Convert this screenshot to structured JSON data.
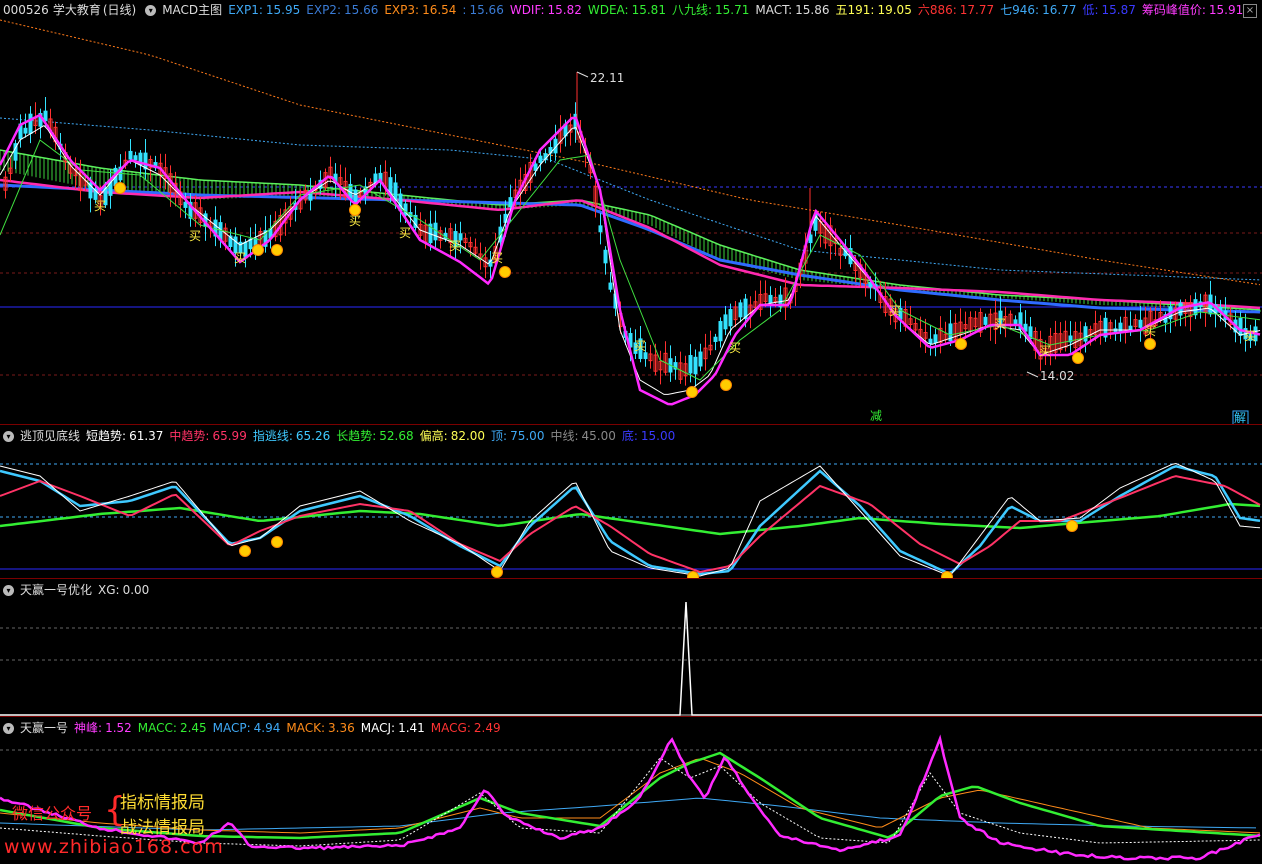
{
  "main": {
    "stock_code": "000526",
    "stock_name": "学大教育",
    "period": "(日线)",
    "indicator": "MACD主图",
    "values": [
      {
        "label": "EXP1:",
        "value": "15.95",
        "color": "#3fa9f5"
      },
      {
        "label": "EXP2:",
        "value": "15.66",
        "color": "#3a7bd5"
      },
      {
        "label": "EXP3:",
        "value": "16.54",
        "color": "#ff8c1a"
      },
      {
        "label": ":",
        "value": "15.66",
        "color": "#3a7bd5"
      },
      {
        "label": "WDIF:",
        "value": "15.82",
        "color": "#ff3cff"
      },
      {
        "label": "WDEA:",
        "value": "15.81",
        "color": "#33ee33"
      },
      {
        "label": "八九线:",
        "value": "15.71",
        "color": "#33ee33"
      },
      {
        "label": "MACT:",
        "value": "15.86",
        "color": "#dddddd"
      },
      {
        "label": "五191:",
        "value": "19.05",
        "color": "#ffff55"
      },
      {
        "label": "六886:",
        "value": "17.77",
        "color": "#ff3333"
      },
      {
        "label": "七946:",
        "value": "16.77",
        "color": "#3fa9f5"
      },
      {
        "label": "低:",
        "value": "15.87",
        "color": "#3a3aff"
      },
      {
        "label": "筹码峰值价:",
        "value": "15.91",
        "color": "#ff3cff"
      }
    ],
    "high_label": "22.11",
    "low_label": "14.02",
    "buy_mark": "买",
    "reduce_mark": "减",
    "release_mark": "解"
  },
  "escape": {
    "title": "逃顶见底线",
    "values": [
      {
        "label": "短趋势:",
        "value": "61.37",
        "color": "#ffffff"
      },
      {
        "label": "中趋势:",
        "value": "65.99",
        "color": "#ff3366"
      },
      {
        "label": "指逃线:",
        "value": "65.26",
        "color": "#3fc9ff"
      },
      {
        "label": "长趋势:",
        "value": "52.68",
        "color": "#33ee33"
      },
      {
        "label": "偏高:",
        "value": "82.00",
        "color": "#ffff55"
      },
      {
        "label": "顶:",
        "value": "75.00",
        "color": "#3fa9f5"
      },
      {
        "label": "中线:",
        "value": "45.00",
        "color": "#888888"
      },
      {
        "label": "底:",
        "value": "15.00",
        "color": "#3a3aff"
      }
    ]
  },
  "tianying_opt": {
    "title": "天赢一号优化",
    "values": [
      {
        "label": "XG:",
        "value": "0.00",
        "color": "#dddddd"
      }
    ]
  },
  "tianying": {
    "title": "天赢一号",
    "values": [
      {
        "label": "神峰:",
        "value": "1.52",
        "color": "#ff3cff"
      },
      {
        "label": "MACC:",
        "value": "2.45",
        "color": "#33ee33"
      },
      {
        "label": "MACP:",
        "value": "4.94",
        "color": "#3fa9f5"
      },
      {
        "label": "MACK:",
        "value": "3.36",
        "color": "#ff8c1a"
      },
      {
        "label": "MACJ:",
        "value": "1.41",
        "color": "#ffffff"
      },
      {
        "label": "MACG:",
        "value": "2.49",
        "color": "#ff3333"
      }
    ]
  },
  "watermark": {
    "left": "微信公众号",
    "line1": "指标情报局",
    "line2": "战法情报局",
    "url": "www.zhibiao168.com"
  }
}
